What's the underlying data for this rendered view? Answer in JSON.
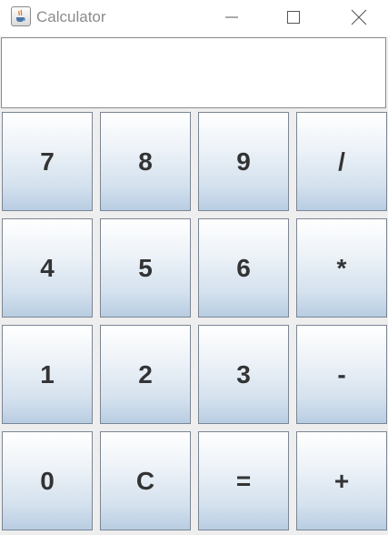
{
  "window": {
    "title": "Calculator",
    "icon": "java-cup-icon",
    "controls": [
      "minimize",
      "maximize",
      "close"
    ]
  },
  "display": {
    "value": ""
  },
  "keypad": {
    "rows": [
      [
        "7",
        "8",
        "9",
        "/"
      ],
      [
        "4",
        "5",
        "6",
        "*"
      ],
      [
        "1",
        "2",
        "3",
        "-"
      ],
      [
        "0",
        "C",
        "=",
        "+"
      ]
    ]
  },
  "colors": {
    "key_gradient_top": "#ffffff",
    "key_gradient_bottom": "#b8cde2",
    "key_border": "#7b8694",
    "background": "#eeeeee"
  }
}
